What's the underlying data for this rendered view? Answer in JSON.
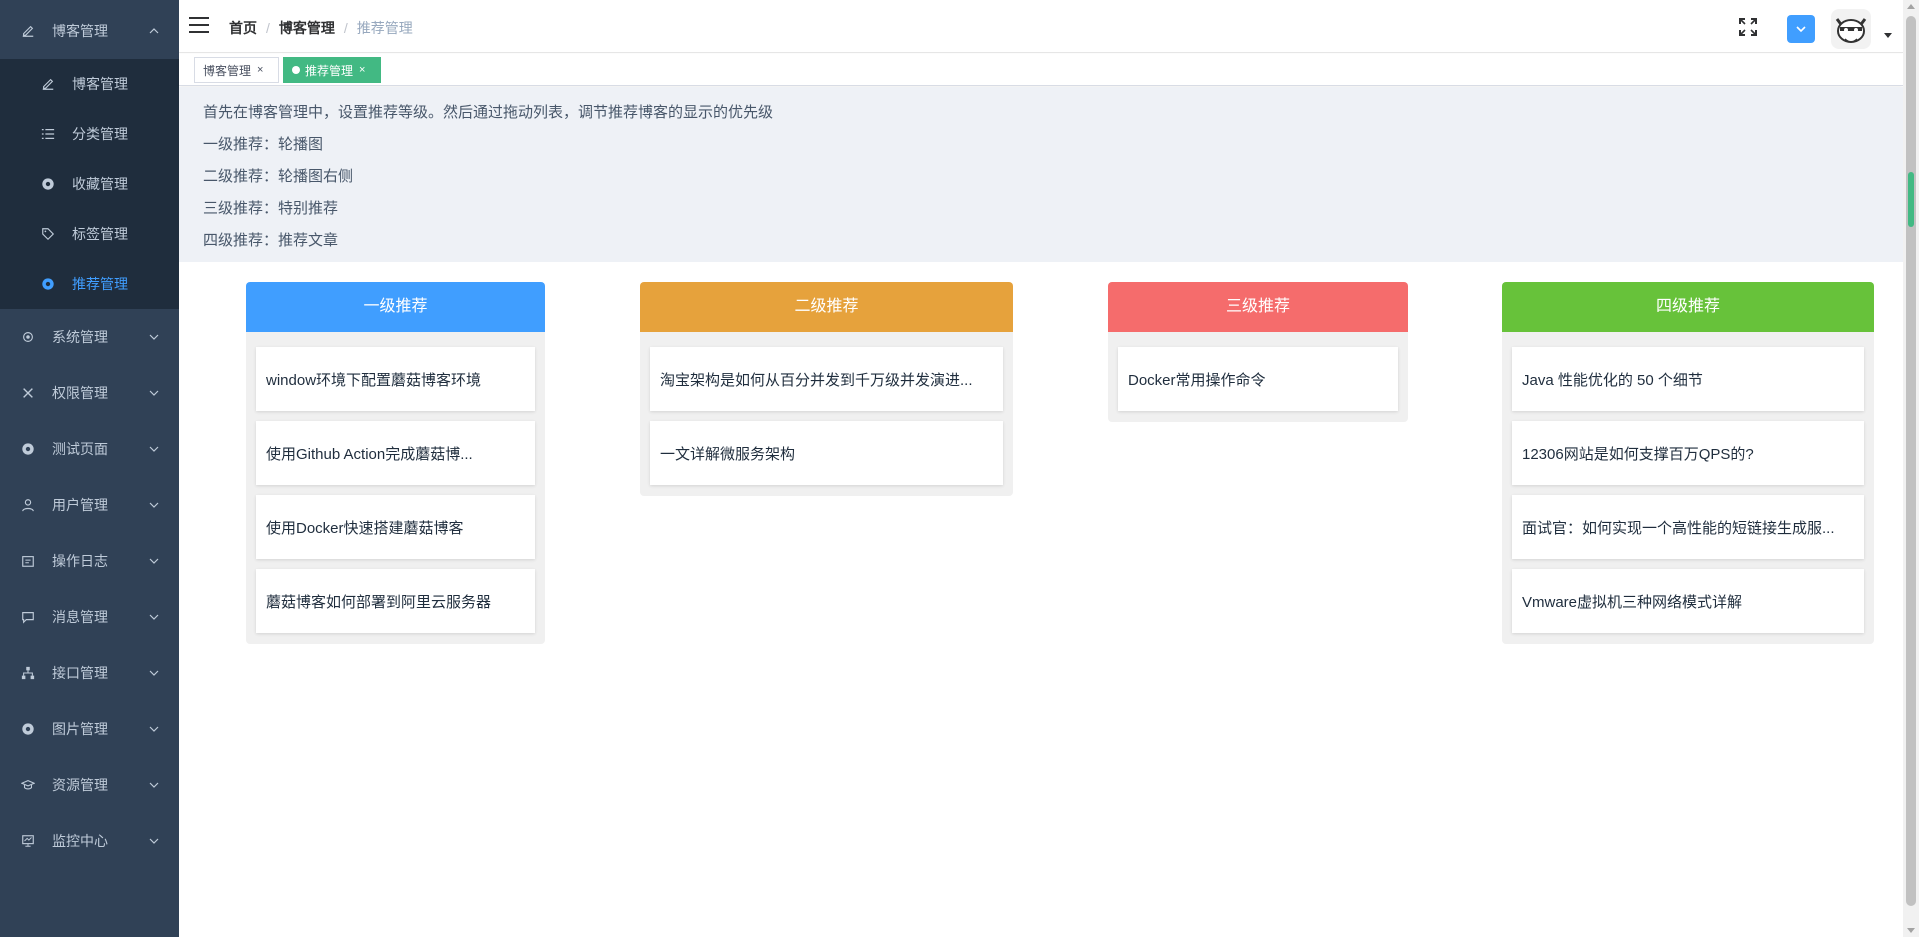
{
  "sidebar": {
    "main_menu": {
      "label": "博客管理",
      "icon": "edit-icon"
    },
    "sub_items": [
      {
        "label": "博客管理",
        "icon": "edit-icon"
      },
      {
        "label": "分类管理",
        "icon": "list-icon"
      },
      {
        "label": "收藏管理",
        "icon": "aperture-icon"
      },
      {
        "label": "标签管理",
        "icon": "tag-icon"
      },
      {
        "label": "推荐管理",
        "icon": "aperture-icon",
        "active": true
      }
    ],
    "menus": [
      {
        "label": "系统管理",
        "icon": "gear-icon"
      },
      {
        "label": "权限管理",
        "icon": "tools-icon"
      },
      {
        "label": "测试页面",
        "icon": "aperture-icon"
      },
      {
        "label": "用户管理",
        "icon": "user-icon"
      },
      {
        "label": "操作日志",
        "icon": "calendar-icon"
      },
      {
        "label": "消息管理",
        "icon": "message-icon"
      },
      {
        "label": "接口管理",
        "icon": "tree-icon"
      },
      {
        "label": "图片管理",
        "icon": "aperture-icon"
      },
      {
        "label": "资源管理",
        "icon": "graduation-icon"
      },
      {
        "label": "监控中心",
        "icon": "monitor-icon"
      }
    ]
  },
  "header": {
    "breadcrumb": [
      "首页",
      "博客管理",
      "推荐管理"
    ],
    "accent_color": "#409eff"
  },
  "tags": [
    {
      "label": "博客管理",
      "close": "×",
      "active": false
    },
    {
      "label": "推荐管理",
      "close": "×",
      "active": true
    }
  ],
  "info": {
    "lines": [
      "首先在博客管理中，设置推荐等级。然后通过拖动列表，调节推荐博客的显示的优先级",
      "一级推荐：轮播图",
      "二级推荐：轮播图右侧",
      "三级推荐：特别推荐",
      "四级推荐：推荐文章"
    ]
  },
  "columns": [
    {
      "title": "一级推荐",
      "color": "#409eff",
      "items": [
        "window环境下配置蘑菇博客环境",
        "使用Github Action完成蘑菇博...",
        "使用Docker快速搭建蘑菇博客",
        "蘑菇博客如何部署到阿里云服务器"
      ]
    },
    {
      "title": "二级推荐",
      "color": "#e6a23c",
      "items": [
        "淘宝架构是如何从百分并发到千万级并发演进...",
        "一文详解微服务架构"
      ]
    },
    {
      "title": "三级推荐",
      "color": "#f56c6c",
      "items": [
        "Docker常用操作命令"
      ]
    },
    {
      "title": "四级推荐",
      "color": "#67c23a",
      "items": [
        "Java 性能优化的 50 个细节",
        "12306网站是如何支撑百万QPS的?",
        "面试官：如何实现一个高性能的短链接生成服...",
        "Vmware虚拟机三种网络模式详解"
      ]
    }
  ]
}
